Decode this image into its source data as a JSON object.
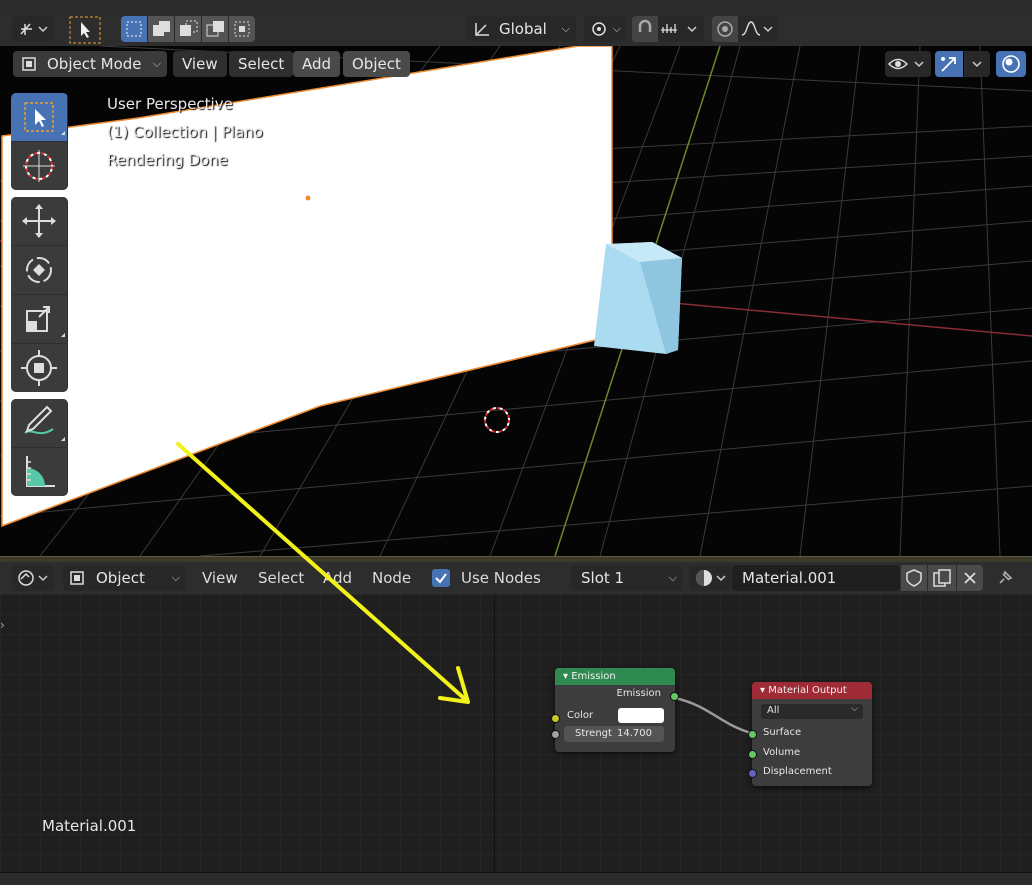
{
  "top_toolbar": {
    "transform_orientation": "Global"
  },
  "viewport_header": {
    "mode": "Object Mode",
    "menus": [
      "View",
      "Select",
      "Add",
      "Object"
    ]
  },
  "overlay": {
    "perspective": "User Perspective",
    "collection": "(1) Collection | Plano",
    "status": "Rendering Done"
  },
  "node_header": {
    "editor_type": "Object",
    "menus": [
      "View",
      "Select",
      "Add",
      "Node"
    ],
    "use_nodes_label": "Use Nodes",
    "slot": "Slot 1",
    "material": "Material.001"
  },
  "nodes": {
    "emission": {
      "title": "Emission",
      "output": "Emission",
      "color_label": "Color",
      "strength_label": "Strengt",
      "strength_value": "14.700"
    },
    "material_output": {
      "title": "Material Output",
      "target": "All",
      "inputs": [
        "Surface",
        "Volume",
        "Displacement"
      ]
    }
  },
  "canvas_label": "Material.001",
  "colors": {
    "accent": "#4772b3",
    "emission_header": "#2f8a52",
    "output_header": "#9e2b35",
    "annotation_arrow": "#f2f21a",
    "selection_outline": "#f08a30"
  }
}
